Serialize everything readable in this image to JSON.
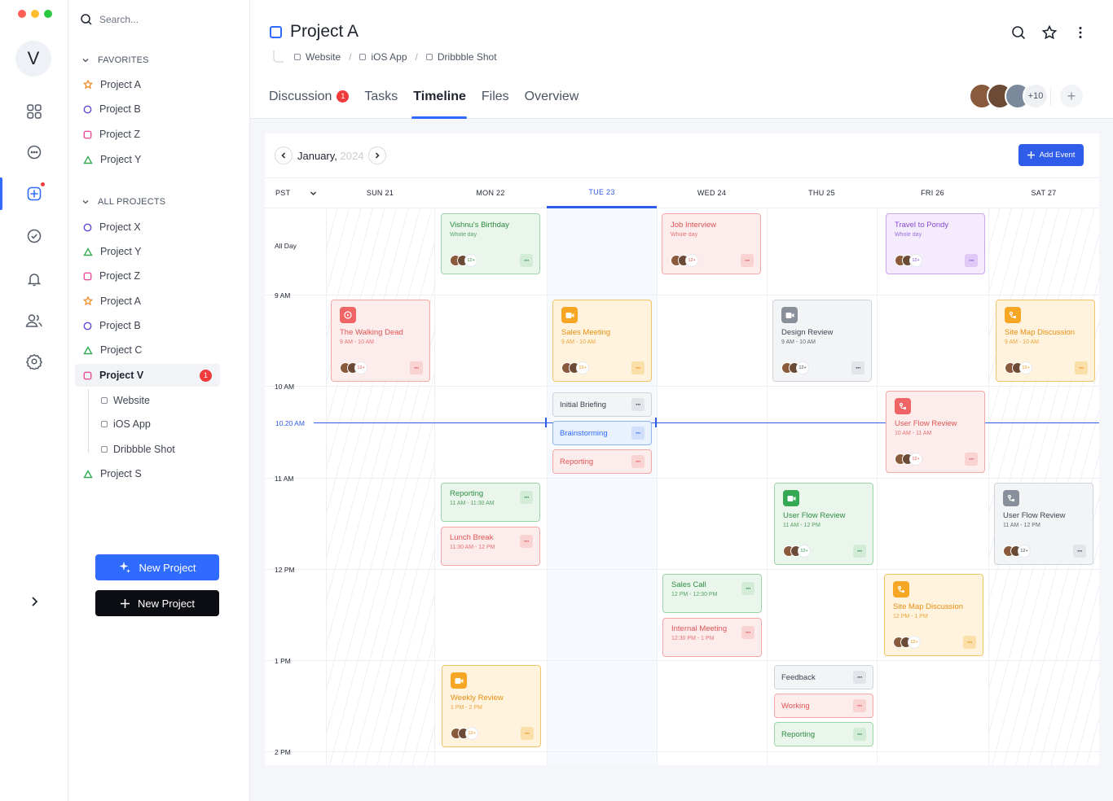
{
  "sidebar": {
    "avatar_letter": "V",
    "search_placeholder": "Search...",
    "favorites_label": "FAVORITES",
    "all_projects_label": "ALL PROJECTS",
    "favorites": [
      {
        "label": "Project A",
        "shape": "star",
        "color": "#f28c28"
      },
      {
        "label": "Project B",
        "shape": "circle",
        "color": "#5b4bd6"
      },
      {
        "label": "Project Z",
        "shape": "square",
        "color": "#e84e9a"
      },
      {
        "label": "Project Y",
        "shape": "triangle",
        "color": "#34a853"
      }
    ],
    "projects": [
      {
        "label": "Project X",
        "shape": "circle",
        "color": "#5b4bd6"
      },
      {
        "label": "Project Y",
        "shape": "triangle",
        "color": "#34a853"
      },
      {
        "label": "Project Z",
        "shape": "square",
        "color": "#e84e9a"
      },
      {
        "label": "Project A",
        "shape": "star",
        "color": "#f28c28"
      },
      {
        "label": "Project B",
        "shape": "circle",
        "color": "#5b4bd6"
      },
      {
        "label": "Project C",
        "shape": "triangle",
        "color": "#34a853"
      },
      {
        "label": "Project V",
        "shape": "square",
        "color": "#e84e9a",
        "badge": "1"
      },
      {
        "label": "Project S",
        "shape": "triangle",
        "color": "#34a853"
      }
    ],
    "subpages": [
      "Website",
      "iOS App",
      "Dribbble Shot"
    ],
    "new_project_primary": "New Project",
    "new_project_dark": "New Project"
  },
  "header": {
    "title": "Project A",
    "breadcrumbs": [
      "Website",
      "iOS App",
      "Dribbble Shot"
    ],
    "tabs": [
      {
        "label": "Discussion",
        "badge": "1"
      },
      {
        "label": "Tasks"
      },
      {
        "label": "Timeline",
        "active": true
      },
      {
        "label": "Files"
      },
      {
        "label": "Overview"
      }
    ],
    "members_more": "+10"
  },
  "calendar": {
    "month": "January,",
    "year": "2024",
    "add_event": "Add Event",
    "timezone": "PST",
    "days": [
      "SUN  21",
      "MON  22",
      "TUE  23",
      "WED  24",
      "THU  25",
      "FRI  26",
      "SAT  27"
    ],
    "all_day_label": "All Day",
    "times": [
      "9 AM",
      "10 AM",
      "11 AM",
      "12  PM",
      "1 PM",
      "2 PM"
    ],
    "now_label": "10.20 AM"
  },
  "events": [
    {
      "title": "Vishnu's Birthday",
      "sub": "Whole day",
      "count": "12+"
    },
    {
      "title": "Job Interview",
      "sub": "Whole day",
      "count": "12+"
    },
    {
      "title": "Travel to Pondy",
      "sub": "Whole day",
      "count": "12+"
    },
    {
      "title": "The Walking Dead",
      "sub": "9 AM - 10 AM",
      "count": "12+"
    },
    {
      "title": "Sales Meeting",
      "sub": "9 AM - 10 AM",
      "count": "12+"
    },
    {
      "title": "Design Review",
      "sub": "9 AM - 10 AM",
      "count": "12+"
    },
    {
      "title": "Site Map Discussion",
      "sub": "9 AM - 10 AM",
      "count": "12+"
    },
    {
      "title": "Initial Briefing"
    },
    {
      "title": "Brainstorming"
    },
    {
      "title": "Reporting"
    },
    {
      "title": "User Flow Review",
      "sub": "10 AM - 11 AM",
      "count": "12+"
    },
    {
      "title": "Reporting",
      "sub": "11 AM - 11:30 AM"
    },
    {
      "title": "Lunch Break",
      "sub": "11:30 AM - 12 PM"
    },
    {
      "title": "User Flow Review",
      "sub": "11 AM - 12 PM",
      "count": "12+"
    },
    {
      "title": "User Flow Review",
      "sub": "11 AM - 12 PM",
      "count": "12+"
    },
    {
      "title": "Sales Call",
      "sub": "12 PM - 12:30 PM"
    },
    {
      "title": "Internal Meeting",
      "sub": "12:30 PM - 1 PM"
    },
    {
      "title": "Site Map Discussion",
      "sub": "12 PM - 1 PM",
      "count": "12+"
    },
    {
      "title": "Weekly Review",
      "sub": "1 PM - 2 PM",
      "count": "12+"
    },
    {
      "title": "Feedback"
    },
    {
      "title": "Working"
    },
    {
      "title": "Reporting"
    }
  ],
  "colors": {
    "accent": "#2f6bff",
    "danger": "#ef3b3b",
    "primary_button": "#2f6bff",
    "dark_button": "#0b0d12"
  }
}
